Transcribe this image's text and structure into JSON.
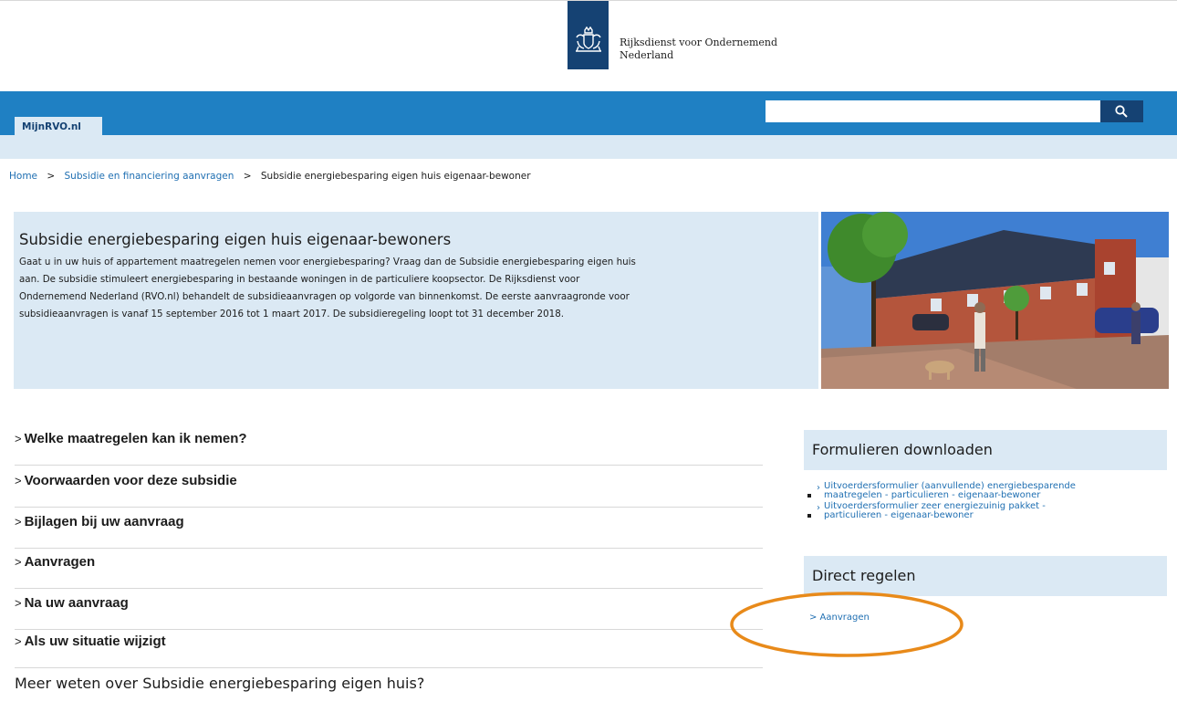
{
  "header": {
    "org_name_line1": "Rijksdienst voor Ondernemend",
    "org_name_line2": "Nederland",
    "logo_icon": "coat-of-arms-icon"
  },
  "nav": {
    "tab_label": "MijnRVO.nl",
    "search_placeholder": "",
    "search_icon": "search-icon"
  },
  "breadcrumb": {
    "items": [
      "Home",
      "Subsidie en financiering aanvragen",
      "Subsidie energiebesparing eigen huis eigenaar-bewoner"
    ],
    "separator": ">"
  },
  "hero": {
    "title": "Subsidie energiebesparing eigen huis eigenaar-bewoners",
    "body_lines": [
      "Gaat u in uw huis of appartement maatregelen nemen voor energiebesparing? Vraag dan de Subsidie energiebesparing eigen huis",
      "aan. De subsidie stimuleert energiebesparing in bestaande woningen in de particuliere koopsector. De Rijksdienst voor",
      "Ondernemend Nederland (RVO.nl) behandelt de subsidieaanvragen op volgorde van binnenkomst. De eerste aanvraagronde voor",
      "subsidieaanvragen is vanaf 15 september 2016 tot 1 maart 2017. De subsidieregeling loopt tot 31 december 2018."
    ]
  },
  "accordion": {
    "chevron": ">",
    "items": [
      "Welke maatregelen kan ik nemen?",
      "Voorwaarden voor deze subsidie",
      "Bijlagen bij uw aanvraag",
      "Aanvragen",
      "Na uw aanvraag",
      "Als uw situatie wijzigt"
    ],
    "more_title": "Meer weten over Subsidie energiebesparing eigen huis?"
  },
  "sidebar": {
    "downloads_title": "Formulieren downloaden",
    "downloads": [
      {
        "line1": "Uitvoerdersformulier (aanvullende) energiebesparende",
        "line2": "maatregelen - particulieren - eigenaar-bewoner"
      },
      {
        "line1": "Uitvoerdersformulier zeer energiezuinig pakket -",
        "line2": "particulieren - eigenaar-bewoner"
      }
    ],
    "direct_title": "Direct regelen",
    "direct_link": "> Aanvragen"
  },
  "colors": {
    "brand_dark": "#154273",
    "bar_blue": "#1f80c3",
    "light_blue": "#dbe9f4",
    "link": "#1f6fb2",
    "highlight": "#e88a1a"
  }
}
